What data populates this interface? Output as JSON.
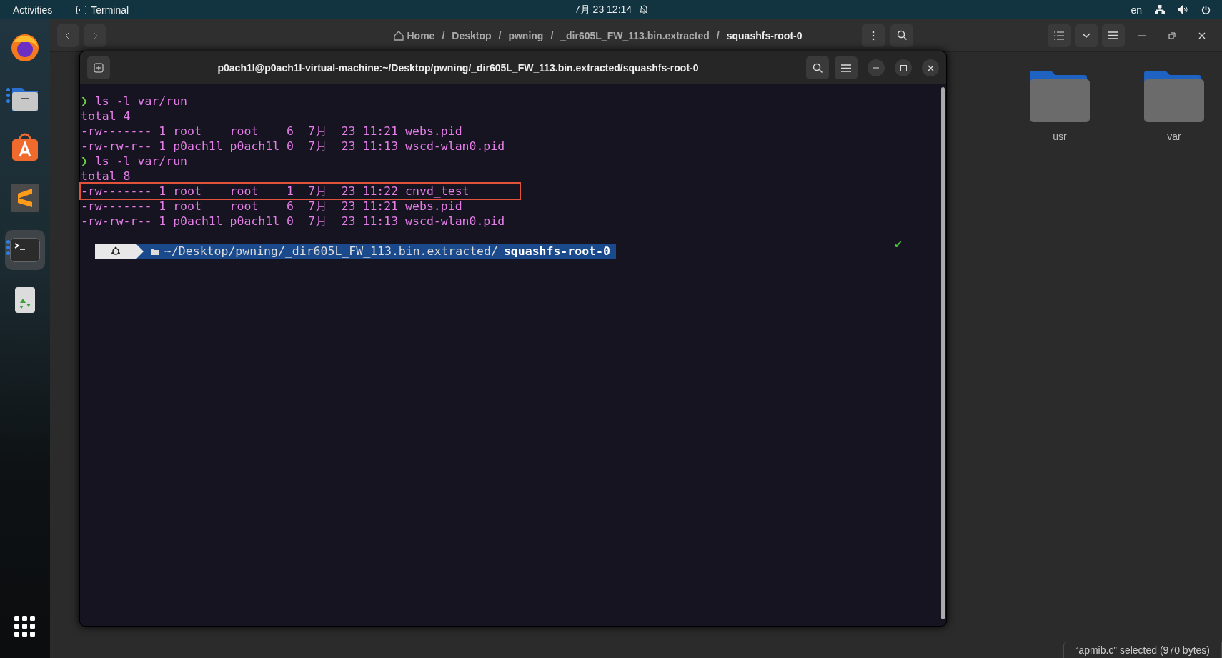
{
  "top_bar": {
    "activities": "Activities",
    "app_name": "Terminal",
    "clock": "7月 23  12:14",
    "language": "en"
  },
  "dock": {
    "items": [
      {
        "kind": "firefox",
        "running": false,
        "selected": false
      },
      {
        "kind": "files",
        "running": true,
        "selected": false
      },
      {
        "kind": "store",
        "running": false,
        "selected": false
      },
      {
        "kind": "editor",
        "running": false,
        "selected": false
      },
      {
        "kind": "terminal",
        "running": true,
        "selected": true
      },
      {
        "kind": "trash",
        "running": false,
        "selected": false
      }
    ]
  },
  "file_manager": {
    "breadcrumbs": [
      {
        "label": "Home",
        "selected": false
      },
      {
        "label": "Desktop",
        "selected": false
      },
      {
        "label": "pwning",
        "selected": false
      },
      {
        "label": "_dir605L_FW_113.bin.extracted",
        "selected": false
      },
      {
        "label": "squashfs-root-0",
        "selected": true
      }
    ],
    "separator": "/",
    "folders": [
      {
        "name": "usr"
      },
      {
        "name": "var"
      }
    ],
    "status": "“apmib.c” selected  (970 bytes)"
  },
  "terminal": {
    "title": "p0ach1l@p0ach1l-virtual-machine:~/Desktop/pwning/_dir605L_FW_113.bin.extracted/squashfs-root-0",
    "lines": [
      {
        "kind": "command",
        "prompt": "❯",
        "text": "ls -l ",
        "path": "var/run"
      },
      {
        "kind": "output",
        "text": "total 4",
        "highlighted": false
      },
      {
        "kind": "output",
        "text": "-rw------- 1 root    root    6  7月  23 11:21 webs.pid",
        "highlighted": false
      },
      {
        "kind": "output",
        "text": "-rw-rw-r-- 1 p0ach1l p0ach1l 0  7月  23 11:13 wscd-wlan0.pid",
        "highlighted": false
      },
      {
        "kind": "command",
        "prompt": "❯",
        "text": "ls -l ",
        "path": "var/run"
      },
      {
        "kind": "output",
        "text": "total 8",
        "highlighted": false
      },
      {
        "kind": "output",
        "text": "-rw------- 1 root    root    1  7月  23 11:22 cnvd_test",
        "highlighted": true
      },
      {
        "kind": "output",
        "text": "-rw------- 1 root    root    6  7月  23 11:21 webs.pid",
        "highlighted": false
      },
      {
        "kind": "output",
        "text": "-rw-rw-r-- 1 p0ach1l p0ach1l 0  7月  23 11:13 wscd-wlan0.pid",
        "highlighted": false
      }
    ],
    "prompt_bar": {
      "path": "~/Desktop/pwning/_dir605L_FW_113.bin.extracted/",
      "current": "squashfs-root-0",
      "status": "✔"
    }
  }
}
